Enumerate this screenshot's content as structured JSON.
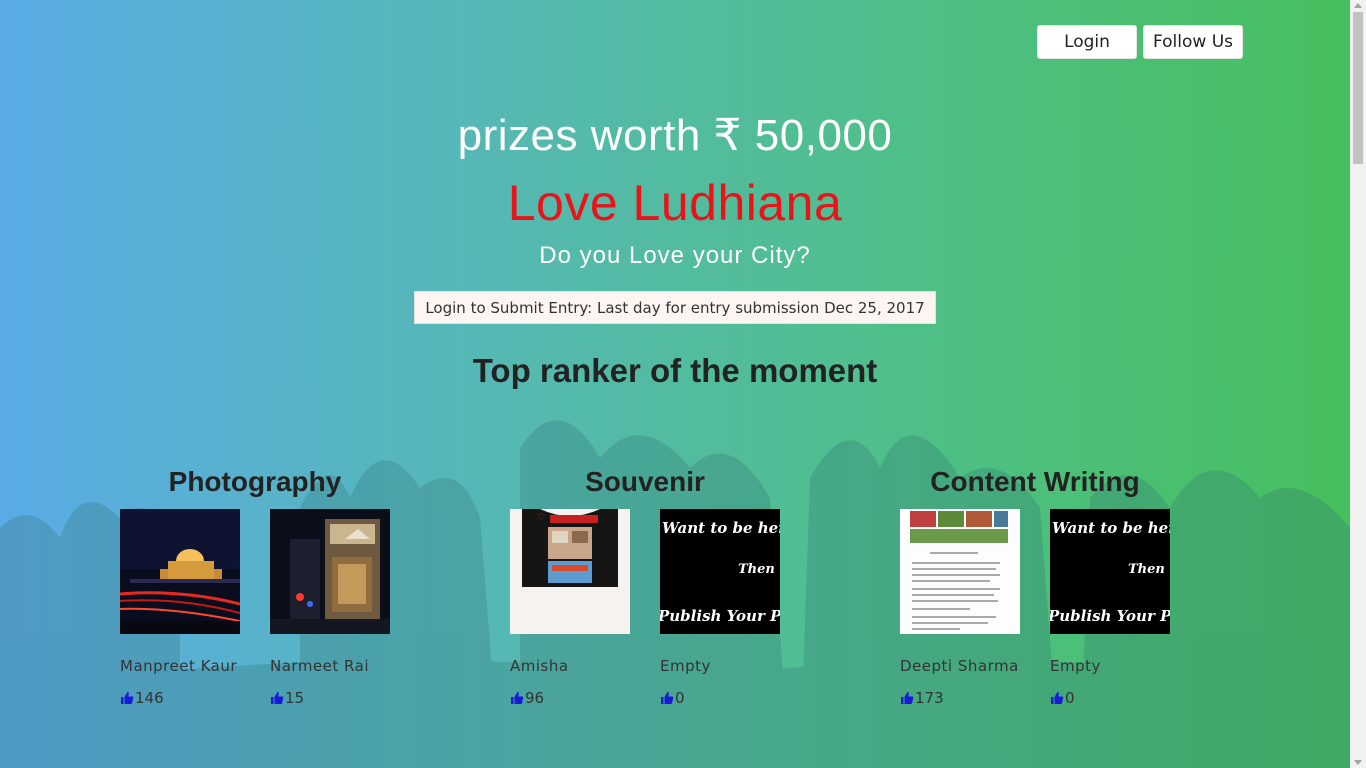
{
  "header": {
    "login_label": "Login",
    "follow_label": "Follow Us"
  },
  "hero": {
    "prizes": "prizes worth ₹ 50,000",
    "title": "Love Ludhiana",
    "tagline": "Do you Love your City?",
    "submit_label": "Login to Submit Entry: Last day for entry submission Dec 25, 2017"
  },
  "rankers": {
    "heading": "Top ranker of the moment",
    "categories": [
      {
        "name": "Photography",
        "entries": [
          {
            "name": "Manpreet Kaur",
            "likes": "146",
            "image": "night-gurdwara-photo"
          },
          {
            "name": "Narmeet Rai",
            "likes": "15",
            "image": "night-mall-photo"
          }
        ]
      },
      {
        "name": "Souvenir",
        "entries": [
          {
            "name": "Amisha",
            "likes": "96",
            "image": "tshirt-photo"
          },
          {
            "name": "Empty",
            "likes": "0",
            "image": "placeholder-publish-post",
            "placeholder_lines": [
              "Want to be here?",
              "Then",
              "Publish Your Post"
            ]
          }
        ]
      },
      {
        "name": "Content Writing",
        "entries": [
          {
            "name": "Deepti Sharma",
            "likes": "173",
            "image": "document-photo"
          },
          {
            "name": "Empty",
            "likes": "0",
            "image": "placeholder-publish-post",
            "placeholder_lines": [
              "Want to be here?",
              "Then",
              "Publish Your Post"
            ]
          }
        ]
      }
    ]
  },
  "colors": {
    "title_red": "#e8141a",
    "like_icon_blue": "#1a1adb"
  },
  "icons": {
    "like": "thumbs-up-icon"
  }
}
